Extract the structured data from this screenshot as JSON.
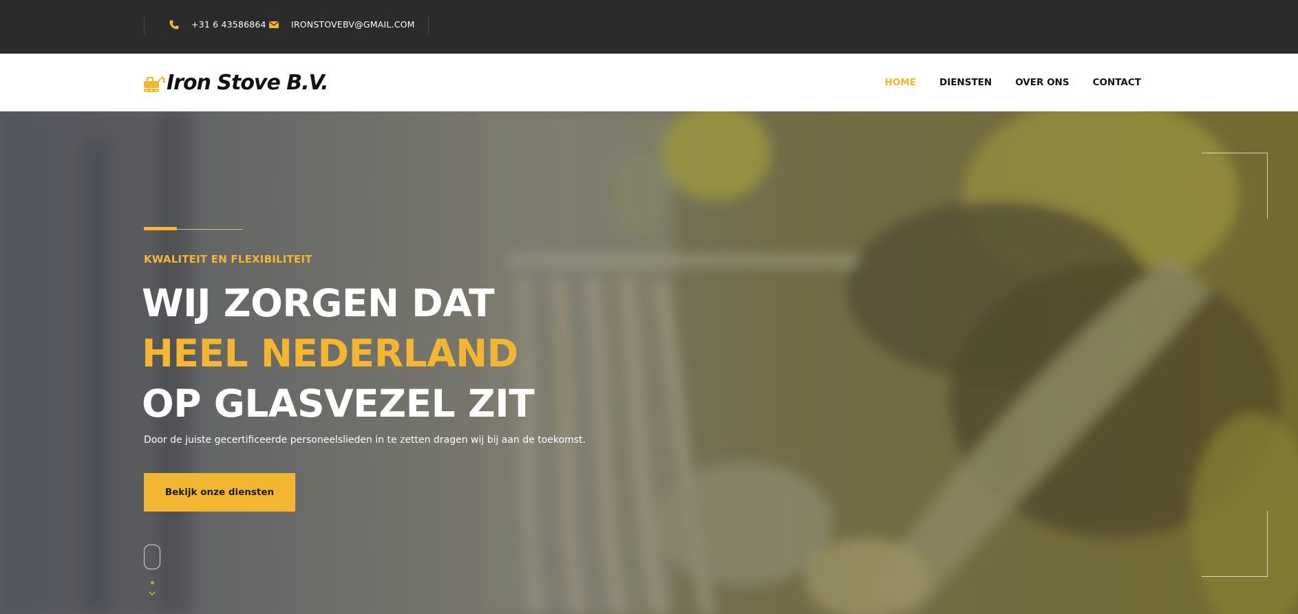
{
  "topbar": {
    "phone": "+31 6 43586864",
    "email": "IRONSTOVEBV@GMAIL.COM",
    "phone_icon": "phone-icon",
    "email_icon": "envelope-icon"
  },
  "header": {
    "logo_text": "Iron Stove B.V.",
    "logo_icon": "excavator-icon",
    "nav": [
      {
        "label": "HOME",
        "active": true
      },
      {
        "label": "DIENSTEN",
        "active": false
      },
      {
        "label": "OVER ONS",
        "active": false
      },
      {
        "label": "CONTACT",
        "active": false
      }
    ]
  },
  "hero": {
    "tagline": "KWALITEIT EN FLEXIBILITEIT",
    "heading_line1": "WIJ ZORGEN DAT",
    "heading_line2": "HEEL NEDERLAND",
    "heading_line3": "OP GLASVEZEL ZIT",
    "subtitle": "Door de juiste gecertificeerde personeelslieden in te zetten dragen wij bij aan de toekomst.",
    "cta_label": "Bekijk onze diensten",
    "scroll_icon": "mouse-scroll-icon",
    "chevron_icon": "chevron-down-icon"
  },
  "colors": {
    "accent": "#f2b632",
    "topbar_bg": "#2b2b2b",
    "header_bg": "#ffffff",
    "text_dark": "#111111"
  }
}
